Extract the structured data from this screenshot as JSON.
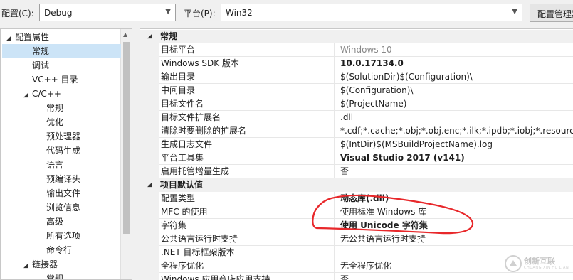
{
  "toolbar": {
    "config_label": "配置(C):",
    "config_value": "Debug",
    "platform_label": "平台(P):",
    "platform_value": "Win32",
    "config_manager_label": "配置管理器"
  },
  "tree": [
    {
      "label": "配置属性",
      "level": 0,
      "expanded": true
    },
    {
      "label": "常规",
      "level": 1,
      "selected": true
    },
    {
      "label": "调试",
      "level": 1
    },
    {
      "label": "VC++ 目录",
      "level": 1
    },
    {
      "label": "C/C++",
      "level": 1,
      "expanded": true
    },
    {
      "label": "常规",
      "level": 2
    },
    {
      "label": "优化",
      "level": 2
    },
    {
      "label": "预处理器",
      "level": 2
    },
    {
      "label": "代码生成",
      "level": 2
    },
    {
      "label": "语言",
      "level": 2
    },
    {
      "label": "预编译头",
      "level": 2
    },
    {
      "label": "输出文件",
      "level": 2
    },
    {
      "label": "浏览信息",
      "level": 2
    },
    {
      "label": "高级",
      "level": 2
    },
    {
      "label": "所有选项",
      "level": 2
    },
    {
      "label": "命令行",
      "level": 2
    },
    {
      "label": "链接器",
      "level": 1,
      "expanded": true
    },
    {
      "label": "常规",
      "level": 2
    }
  ],
  "grid": {
    "sections": [
      {
        "title": "常规",
        "rows": [
          {
            "name": "目标平台",
            "value": "Windows 10",
            "style": "gray"
          },
          {
            "name": "Windows SDK 版本",
            "value": "10.0.17134.0",
            "style": "bold"
          },
          {
            "name": "输出目录",
            "value": "$(SolutionDir)$(Configuration)\\",
            "style": ""
          },
          {
            "name": "中间目录",
            "value": "$(Configuration)\\",
            "style": ""
          },
          {
            "name": "目标文件名",
            "value": "$(ProjectName)",
            "style": ""
          },
          {
            "name": "目标文件扩展名",
            "value": ".dll",
            "style": ""
          },
          {
            "name": "清除时要删除的扩展名",
            "value": "*.cdf;*.cache;*.obj;*.obj.enc;*.ilk;*.ipdb;*.iobj;*.resources;*.tlb;",
            "style": ""
          },
          {
            "name": "生成日志文件",
            "value": "$(IntDir)$(MSBuildProjectName).log",
            "style": ""
          },
          {
            "name": "平台工具集",
            "value": "Visual Studio 2017 (v141)",
            "style": "bold"
          },
          {
            "name": "启用托管增量生成",
            "value": "否",
            "style": ""
          }
        ]
      },
      {
        "title": "项目默认值",
        "rows": [
          {
            "name": "配置类型",
            "value": "动态库(.dll)",
            "style": "bold"
          },
          {
            "name": "MFC 的使用",
            "value": "使用标准 Windows 库",
            "style": ""
          },
          {
            "name": "字符集",
            "value": "使用 Unicode 字符集",
            "style": "bold"
          },
          {
            "name": "公共语言运行时支持",
            "value": "无公共语言运行时支持",
            "style": ""
          },
          {
            "name": ".NET 目标框架版本",
            "value": "",
            "style": ""
          },
          {
            "name": "全程序优化",
            "value": "无全程序优化",
            "style": ""
          },
          {
            "name": "Windows 应用商店应用支持",
            "value": "否",
            "style": ""
          }
        ]
      }
    ]
  },
  "annotation_color": "#e8282b",
  "watermark": {
    "text": "创新互联",
    "sub": "CHUANG XIN HU LIAN"
  }
}
